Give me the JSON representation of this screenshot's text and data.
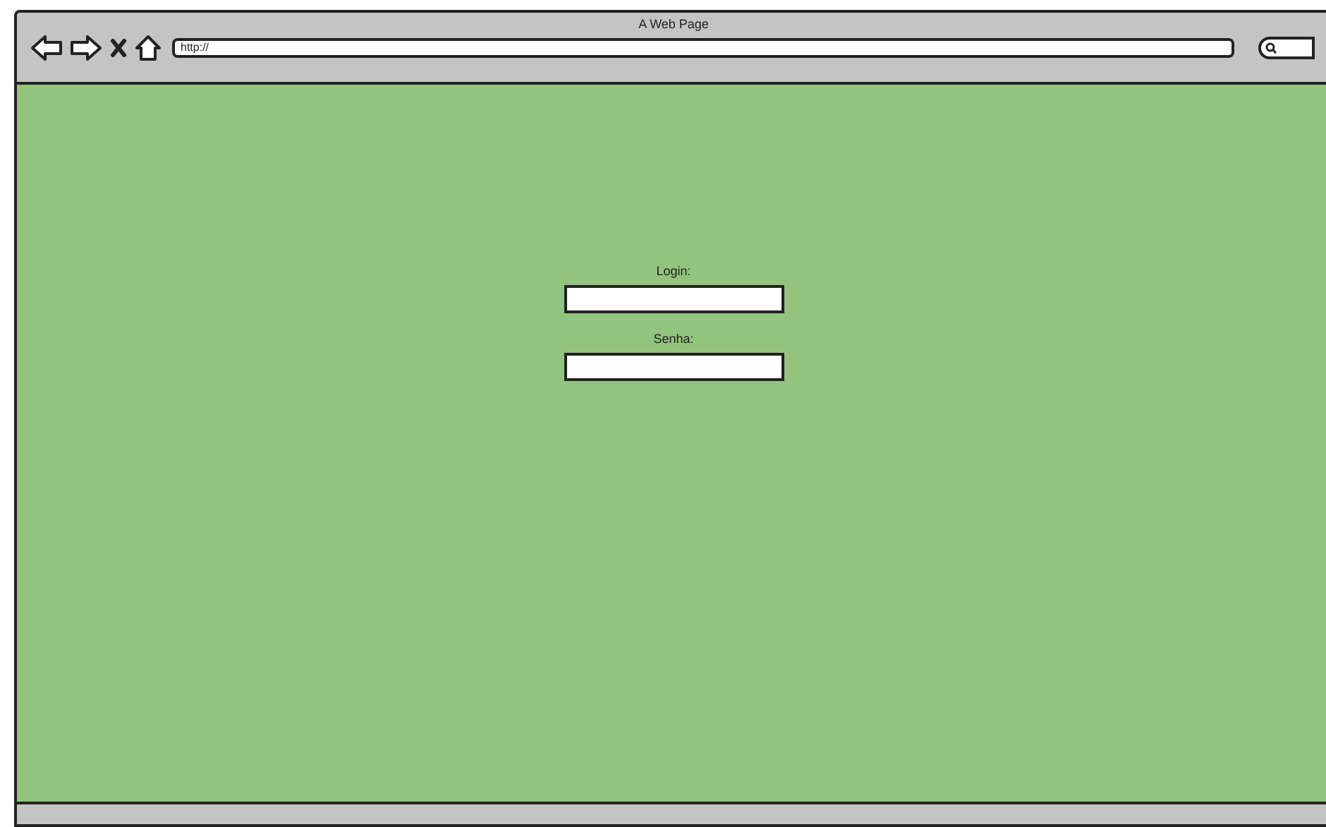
{
  "window": {
    "title": "A Web Page"
  },
  "address_bar": {
    "value": "http://"
  },
  "form": {
    "fields": [
      {
        "label": "Login:"
      },
      {
        "label": "Senha:"
      }
    ]
  }
}
